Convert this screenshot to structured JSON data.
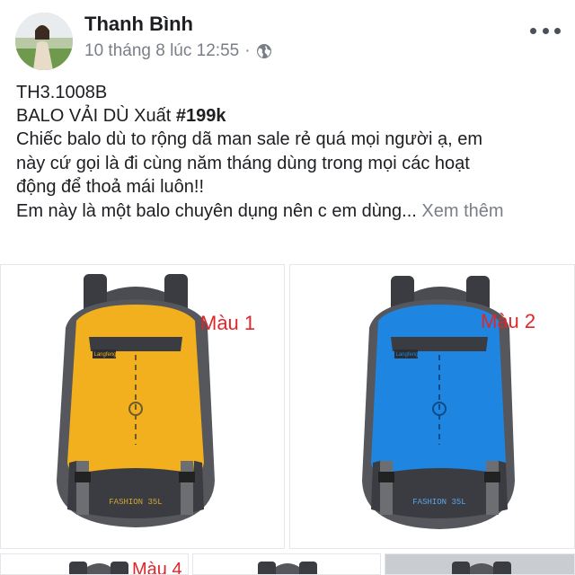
{
  "post": {
    "author": "Thanh Bình",
    "timestamp": "10 tháng 8 lúc 12:55",
    "separator": "·",
    "privacy_icon": "globe-icon",
    "more_icon": "more-options-icon",
    "code_line": "TH3.1008B",
    "title_prefix": "BALO VẢI DÙ Xuất ",
    "title_price": "#199k",
    "body_lines": [
      "Chiếc balo dù to rộng dã man sale rẻ quá mọi người ạ, em",
      "này cứ gọi là đi cùng năm tháng dùng trong mọi các hoạt",
      "động để thoả mái luôn!!",
      "Em này là một balo chuyên dụng nên c em dùng..."
    ],
    "see_more": "Xem thêm"
  },
  "photos": {
    "items": [
      {
        "color_label": "Màu 1",
        "brand_tag": "Langfeng",
        "bottom_text": "FASHION 35L",
        "main_color": "#f2b01e"
      },
      {
        "color_label": "Màu 2",
        "brand_tag": "Langfeng",
        "bottom_text": "FASHION 35L",
        "main_color": "#1e86e0"
      },
      {
        "color_label": "Màu 4",
        "main_color": "#55575c"
      },
      {
        "main_color": "#55575c"
      },
      {
        "main_color": "#55575c"
      }
    ]
  }
}
